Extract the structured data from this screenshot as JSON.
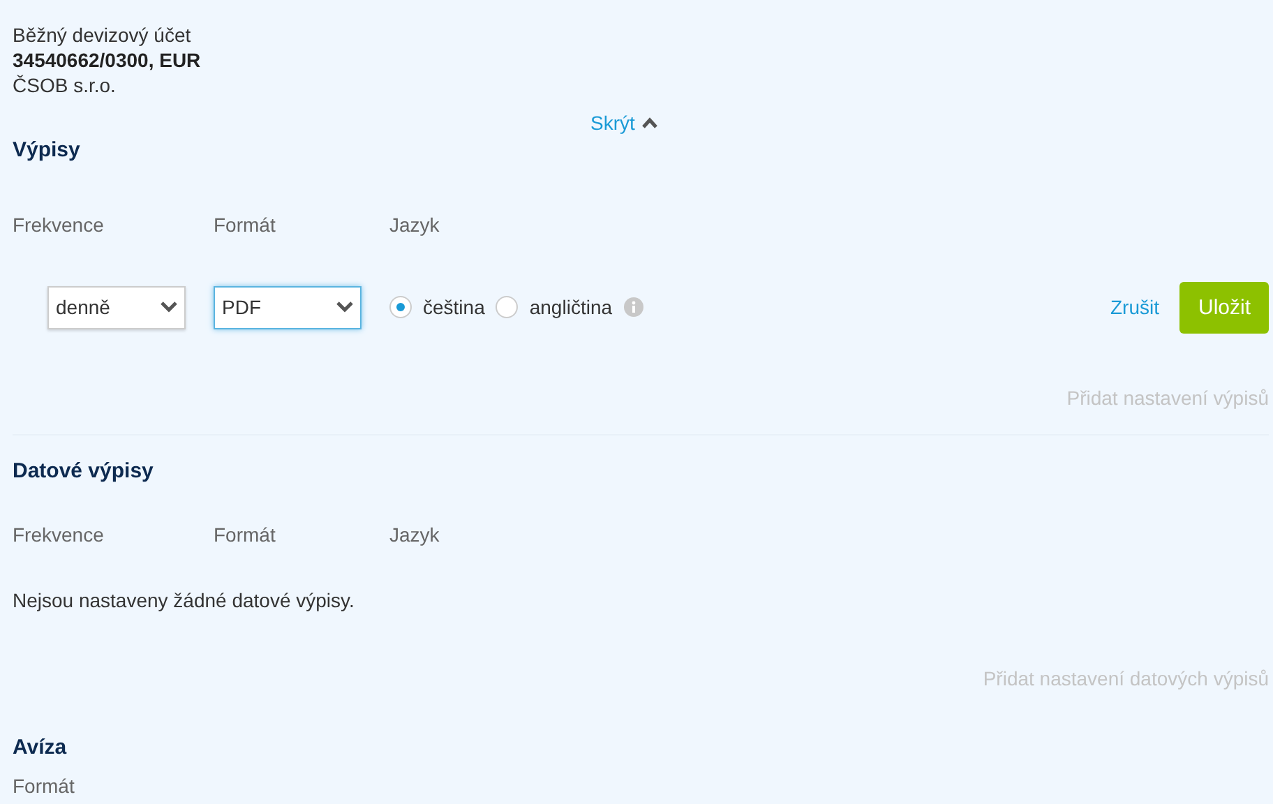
{
  "account": {
    "name": "Běžný devizový účet",
    "number": "34540662/0300, EUR",
    "bank": "ČSOB s.r.o."
  },
  "toggle": {
    "label": "Skrýt",
    "expanded": true
  },
  "statements": {
    "title": "Výpisy",
    "columns": [
      "Frekvence",
      "Formát",
      "Jazyk"
    ],
    "editor": {
      "frequency": {
        "value": "denně",
        "focused": false
      },
      "format": {
        "value": "PDF",
        "focused": true
      },
      "languages": [
        {
          "label": "čeština",
          "selected": true
        },
        {
          "label": "angličtina",
          "selected": false
        }
      ],
      "cancel": "Zrušit",
      "save": "Uložit"
    },
    "add": "Přidat nastavení výpisů"
  },
  "data_statements": {
    "title": "Datové výpisy",
    "columns": [
      "Frekvence",
      "Formát",
      "Jazyk"
    ],
    "empty": "Nejsou nastaveny žádné datové výpisy.",
    "add": "Přidat nastavení datových výpisů"
  },
  "notices": {
    "title": "Avíza",
    "columns": [
      "Formát"
    ]
  }
}
